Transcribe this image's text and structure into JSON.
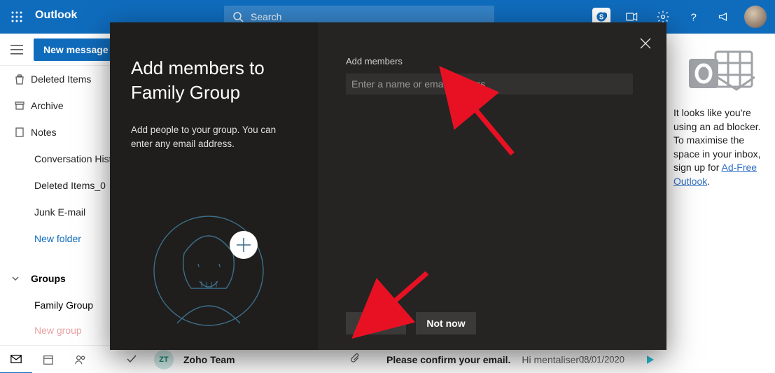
{
  "topbar": {
    "brand": "Outlook",
    "search_placeholder": "Search"
  },
  "cmd": {
    "newmsg": "New message"
  },
  "folders": [
    {
      "label": "Deleted Items",
      "icon": "trash"
    },
    {
      "label": "Archive",
      "icon": "archive"
    },
    {
      "label": "Notes",
      "icon": "note"
    },
    {
      "label": "Conversation History"
    },
    {
      "label": "Deleted Items_0"
    },
    {
      "label": "Junk E-mail"
    },
    {
      "label": "New folder",
      "link": true
    }
  ],
  "groups": {
    "header": "Groups",
    "items": [
      "Family Group",
      "New group"
    ]
  },
  "ad": {
    "text_pre": "It looks like you're using an ad blocker. To maximise the space in your inbox, sign up for ",
    "link": "Ad-Free Outlook",
    "text_post": "."
  },
  "msg": {
    "initials": "ZT",
    "sender": "Zoho Team",
    "subject": "Please confirm your email.",
    "preview": "Hi mentaliser !...",
    "date": "08/01/2020"
  },
  "dialog": {
    "title_line1": "Add members to",
    "title_line2": "Family Group",
    "subtitle": "Add people to your group. You can enter any email address.",
    "field_label": "Add members",
    "placeholder": "Enter a name or email address",
    "add_btn": "Add",
    "notnow_btn": "Not now"
  }
}
